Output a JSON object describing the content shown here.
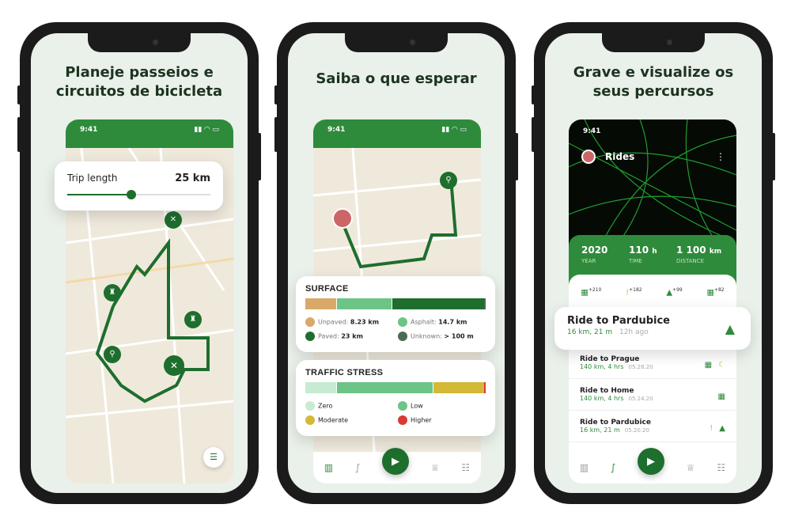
{
  "phone1": {
    "headline": [
      "Planeje passeios e",
      "circuitos de bicicleta"
    ],
    "time": "9:41",
    "trip_label": "Trip length",
    "trip_value": "25 km",
    "slider_fraction": 0.45
  },
  "phone2": {
    "headline": "Saiba o que esperar",
    "time": "9:41",
    "surface": {
      "title": "SURFACE",
      "items": [
        {
          "label": "Unpaved:",
          "value": "8.23 km",
          "color": "#d9a96a"
        },
        {
          "label": "Asphalt:",
          "value": "14.7 km",
          "color": "#6cc486"
        },
        {
          "label": "Paved:",
          "value": "23 km",
          "color": "#1e6e2e"
        },
        {
          "label": "Unknown:",
          "value": "> 100 m",
          "color": "#4d6b52"
        }
      ]
    },
    "traffic": {
      "title": "TRAFFIC STRESS",
      "items": [
        {
          "label": "Zero",
          "color": "#c6ebd2"
        },
        {
          "label": "Low",
          "color": "#6cc486"
        },
        {
          "label": "Moderate",
          "color": "#d4b838"
        },
        {
          "label": "Higher",
          "color": "#d93a32"
        }
      ]
    }
  },
  "phone3": {
    "headline": [
      "Grave e visualize os",
      "seus percursos"
    ],
    "time": "9:41",
    "title": "Rides",
    "stats": [
      {
        "value": "2020",
        "unit": "",
        "label": "YEAR"
      },
      {
        "value": "110",
        "unit": "h",
        "label": "TIME"
      },
      {
        "value": "1 100",
        "unit": "km",
        "label": "DISTANCE"
      }
    ],
    "badges": [
      "+210",
      "+182",
      "+99",
      "+82"
    ],
    "featured": {
      "name": "Ride to Pardubice",
      "meta": "16 km, 21 m",
      "ago": "12h ago"
    },
    "rides": [
      {
        "name": "Ride to Prague",
        "meta": "140 km, 4 hrs",
        "date": "05.28.20"
      },
      {
        "name": "Ride to Home",
        "meta": "140 km, 4 hrs",
        "date": "05.24.20"
      },
      {
        "name": "Ride to Pardubice",
        "meta": "16 km, 21 m",
        "date": "05.20.20"
      }
    ]
  },
  "accent": "#2e8b3c"
}
